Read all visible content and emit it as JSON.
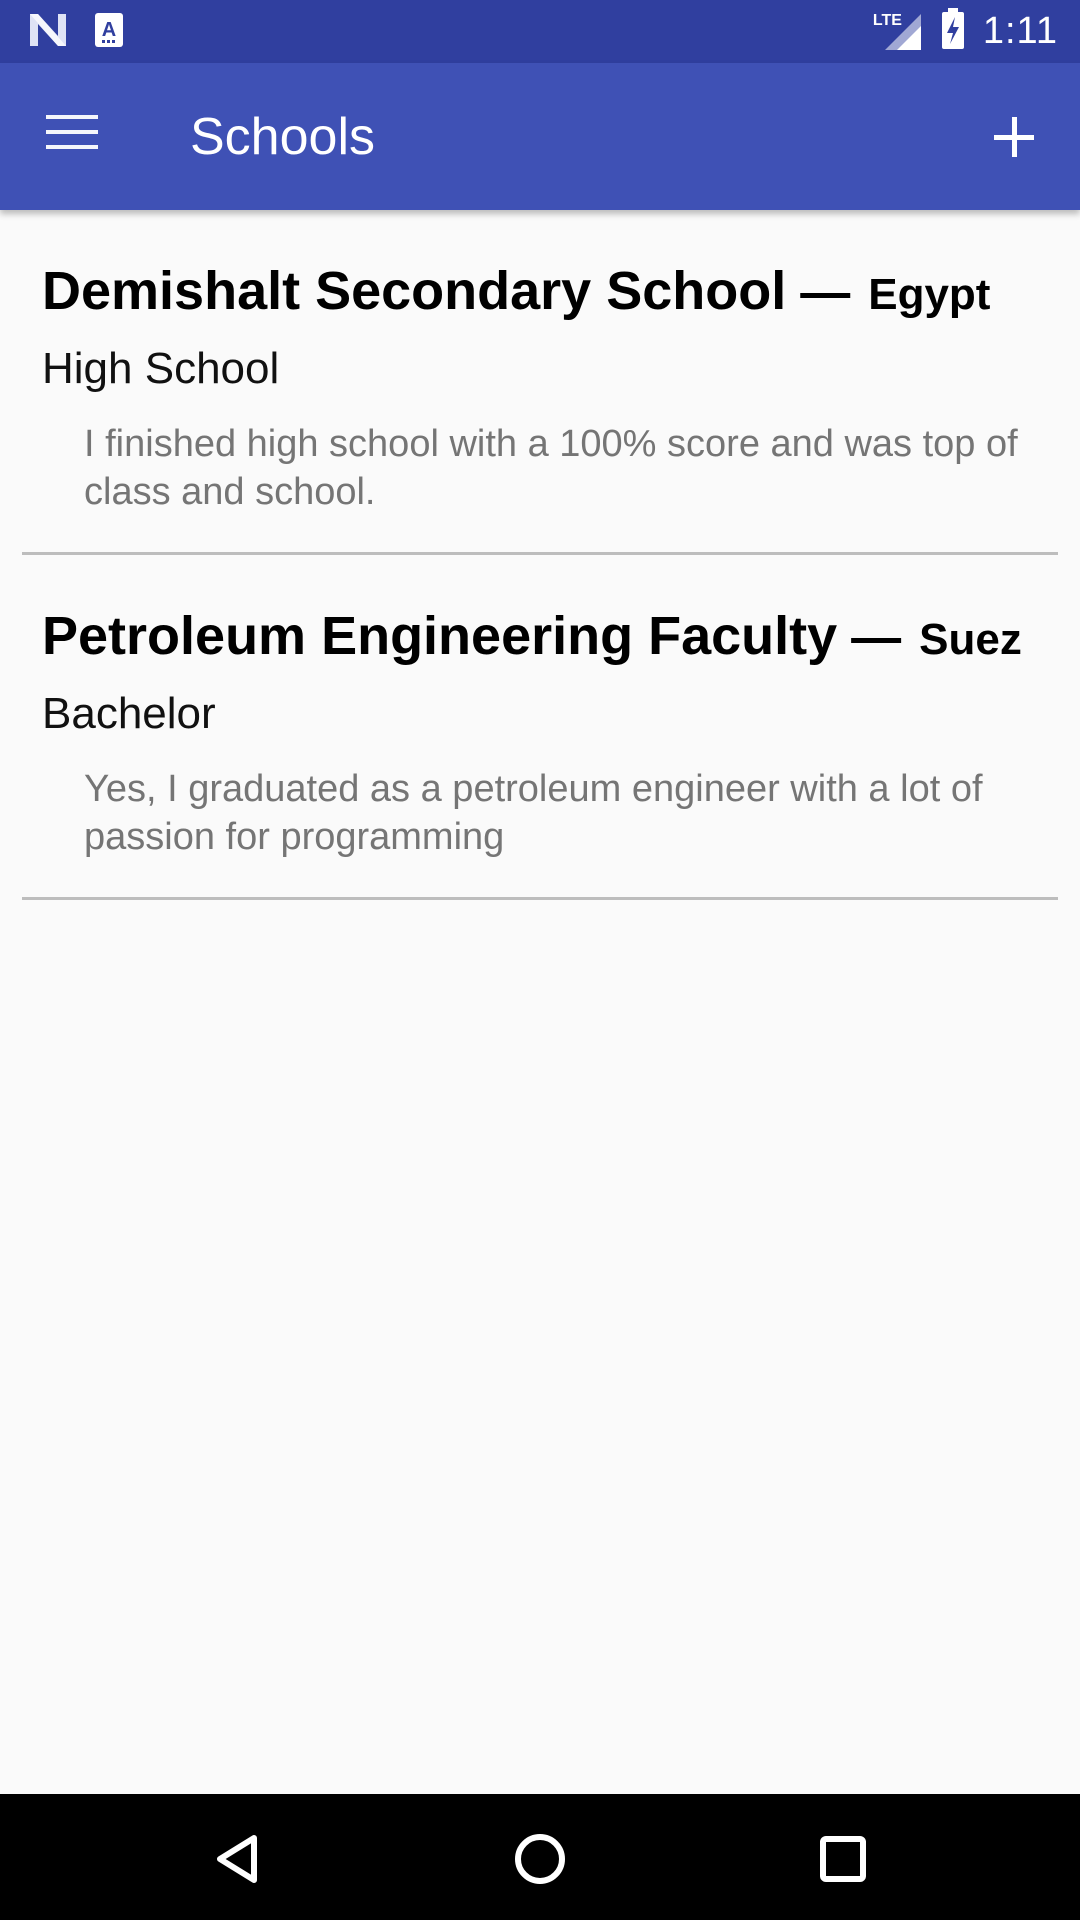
{
  "status_bar": {
    "time": "1:11",
    "network_label": "LTE",
    "icons": [
      "notification-n-icon",
      "keyboard-a-icon",
      "signal-icon",
      "battery-charging-icon"
    ]
  },
  "app_bar": {
    "title": "Schools",
    "menu_icon": "menu-icon",
    "add_icon": "add-icon",
    "color": "#3f51b5",
    "status_color": "#303f9f"
  },
  "schools": [
    {
      "name": "Demishalt Secondary School",
      "separator": "—",
      "location": "Egypt",
      "degree": "High School",
      "description": "I finished high school with a 100% score and was top of class and school."
    },
    {
      "name": "Petroleum Engineering Faculty",
      "separator": "—",
      "location": "Suez",
      "degree": "Bachelor",
      "description": "Yes, I graduated as a petroleum engineer with a lot of passion for programming"
    }
  ],
  "nav_bar": {
    "buttons": [
      "back-icon",
      "home-icon",
      "recents-icon"
    ]
  }
}
